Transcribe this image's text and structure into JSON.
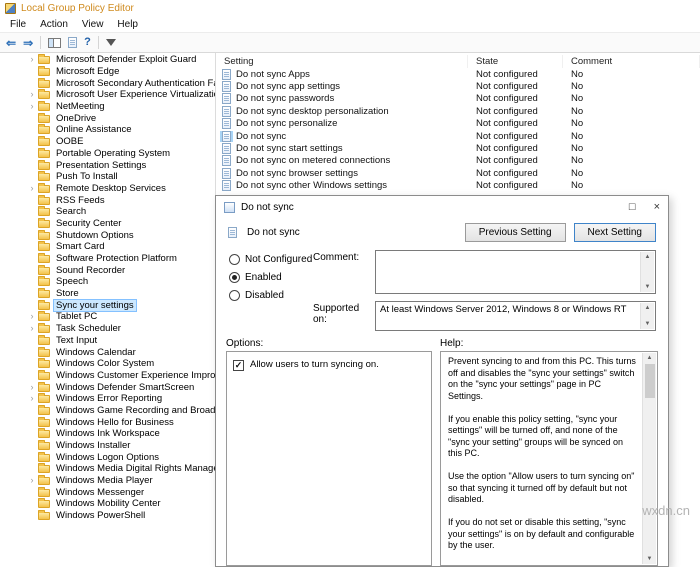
{
  "window": {
    "title": "Local Group Policy Editor",
    "menus": [
      "File",
      "Action",
      "View",
      "Help"
    ]
  },
  "tree": {
    "items": [
      {
        "label": "Microsoft Defender Exploit Guard",
        "expandable": true
      },
      {
        "label": "Microsoft Edge"
      },
      {
        "label": "Microsoft Secondary Authentication Fa"
      },
      {
        "label": "Microsoft User Experience Virtualizatio",
        "expandable": true
      },
      {
        "label": "NetMeeting",
        "expandable": true
      },
      {
        "label": "OneDrive"
      },
      {
        "label": "Online Assistance"
      },
      {
        "label": "OOBE"
      },
      {
        "label": "Portable Operating System"
      },
      {
        "label": "Presentation Settings"
      },
      {
        "label": "Push To Install"
      },
      {
        "label": "Remote Desktop Services",
        "expandable": true
      },
      {
        "label": "RSS Feeds"
      },
      {
        "label": "Search"
      },
      {
        "label": "Security Center"
      },
      {
        "label": "Shutdown Options"
      },
      {
        "label": "Smart Card"
      },
      {
        "label": "Software Protection Platform"
      },
      {
        "label": "Sound Recorder"
      },
      {
        "label": "Speech"
      },
      {
        "label": "Store"
      },
      {
        "label": "Sync your settings",
        "selected": true
      },
      {
        "label": "Tablet PC",
        "expandable": true
      },
      {
        "label": "Task Scheduler",
        "expandable": true
      },
      {
        "label": "Text Input"
      },
      {
        "label": "Windows Calendar"
      },
      {
        "label": "Windows Color System"
      },
      {
        "label": "Windows Customer Experience Improv"
      },
      {
        "label": "Windows Defender SmartScreen",
        "expandable": true
      },
      {
        "label": "Windows Error Reporting",
        "expandable": true
      },
      {
        "label": "Windows Game Recording and Broadca"
      },
      {
        "label": "Windows Hello for Business"
      },
      {
        "label": "Windows Ink Workspace"
      },
      {
        "label": "Windows Installer"
      },
      {
        "label": "Windows Logon Options"
      },
      {
        "label": "Windows Media Digital Rights Manager"
      },
      {
        "label": "Windows Media Player",
        "expandable": true
      },
      {
        "label": "Windows Messenger"
      },
      {
        "label": "Windows Mobility Center"
      },
      {
        "label": "Windows PowerShell"
      }
    ]
  },
  "list": {
    "columns": [
      "Setting",
      "State",
      "Comment"
    ],
    "rows": [
      {
        "setting": "Do not sync Apps",
        "state": "Not configured",
        "comment": "No"
      },
      {
        "setting": "Do not sync app settings",
        "state": "Not configured",
        "comment": "No"
      },
      {
        "setting": "Do not sync passwords",
        "state": "Not configured",
        "comment": "No"
      },
      {
        "setting": "Do not sync desktop personalization",
        "state": "Not configured",
        "comment": "No"
      },
      {
        "setting": "Do not sync personalize",
        "state": "Not configured",
        "comment": "No"
      },
      {
        "setting": "Do not sync",
        "state": "Not configured",
        "comment": "No",
        "selected": true
      },
      {
        "setting": "Do not sync start settings",
        "state": "Not configured",
        "comment": "No"
      },
      {
        "setting": "Do not sync on metered connections",
        "state": "Not configured",
        "comment": "No"
      },
      {
        "setting": "Do not sync browser settings",
        "state": "Not configured",
        "comment": "No"
      },
      {
        "setting": "Do not sync other Windows settings",
        "state": "Not configured",
        "comment": "No"
      }
    ]
  },
  "dialog": {
    "title": "Do not sync",
    "policy_name": "Do not sync",
    "previous_button": "Previous Setting",
    "next_button": "Next Setting",
    "radios": {
      "not_configured": "Not Configured",
      "enabled": "Enabled",
      "disabled": "Disabled",
      "selected": "enabled"
    },
    "comment_label": "Comment:",
    "comment_value": "",
    "supported_label": "Supported on:",
    "supported_value": "At least Windows Server 2012, Windows 8 or Windows RT",
    "options_label": "Options:",
    "help_label": "Help:",
    "option_checkbox": {
      "label": "Allow users to turn syncing on.",
      "checked": true
    },
    "help_text": "Prevent syncing to and from this PC. This turns off and disables the \"sync your settings\" switch on the \"sync your settings\" page in PC Settings.\n\nIf you enable this policy setting, \"sync your settings\" will be turned off, and none of the \"sync your setting\" groups will be synced on this PC.\n\nUse the option \"Allow users to turn syncing on\" so that syncing it turned off by default but not disabled.\n\nIf you do not set or disable this setting, \"sync your settings\" is on by default and configurable by the user."
  },
  "watermark": "wxdn.cn"
}
